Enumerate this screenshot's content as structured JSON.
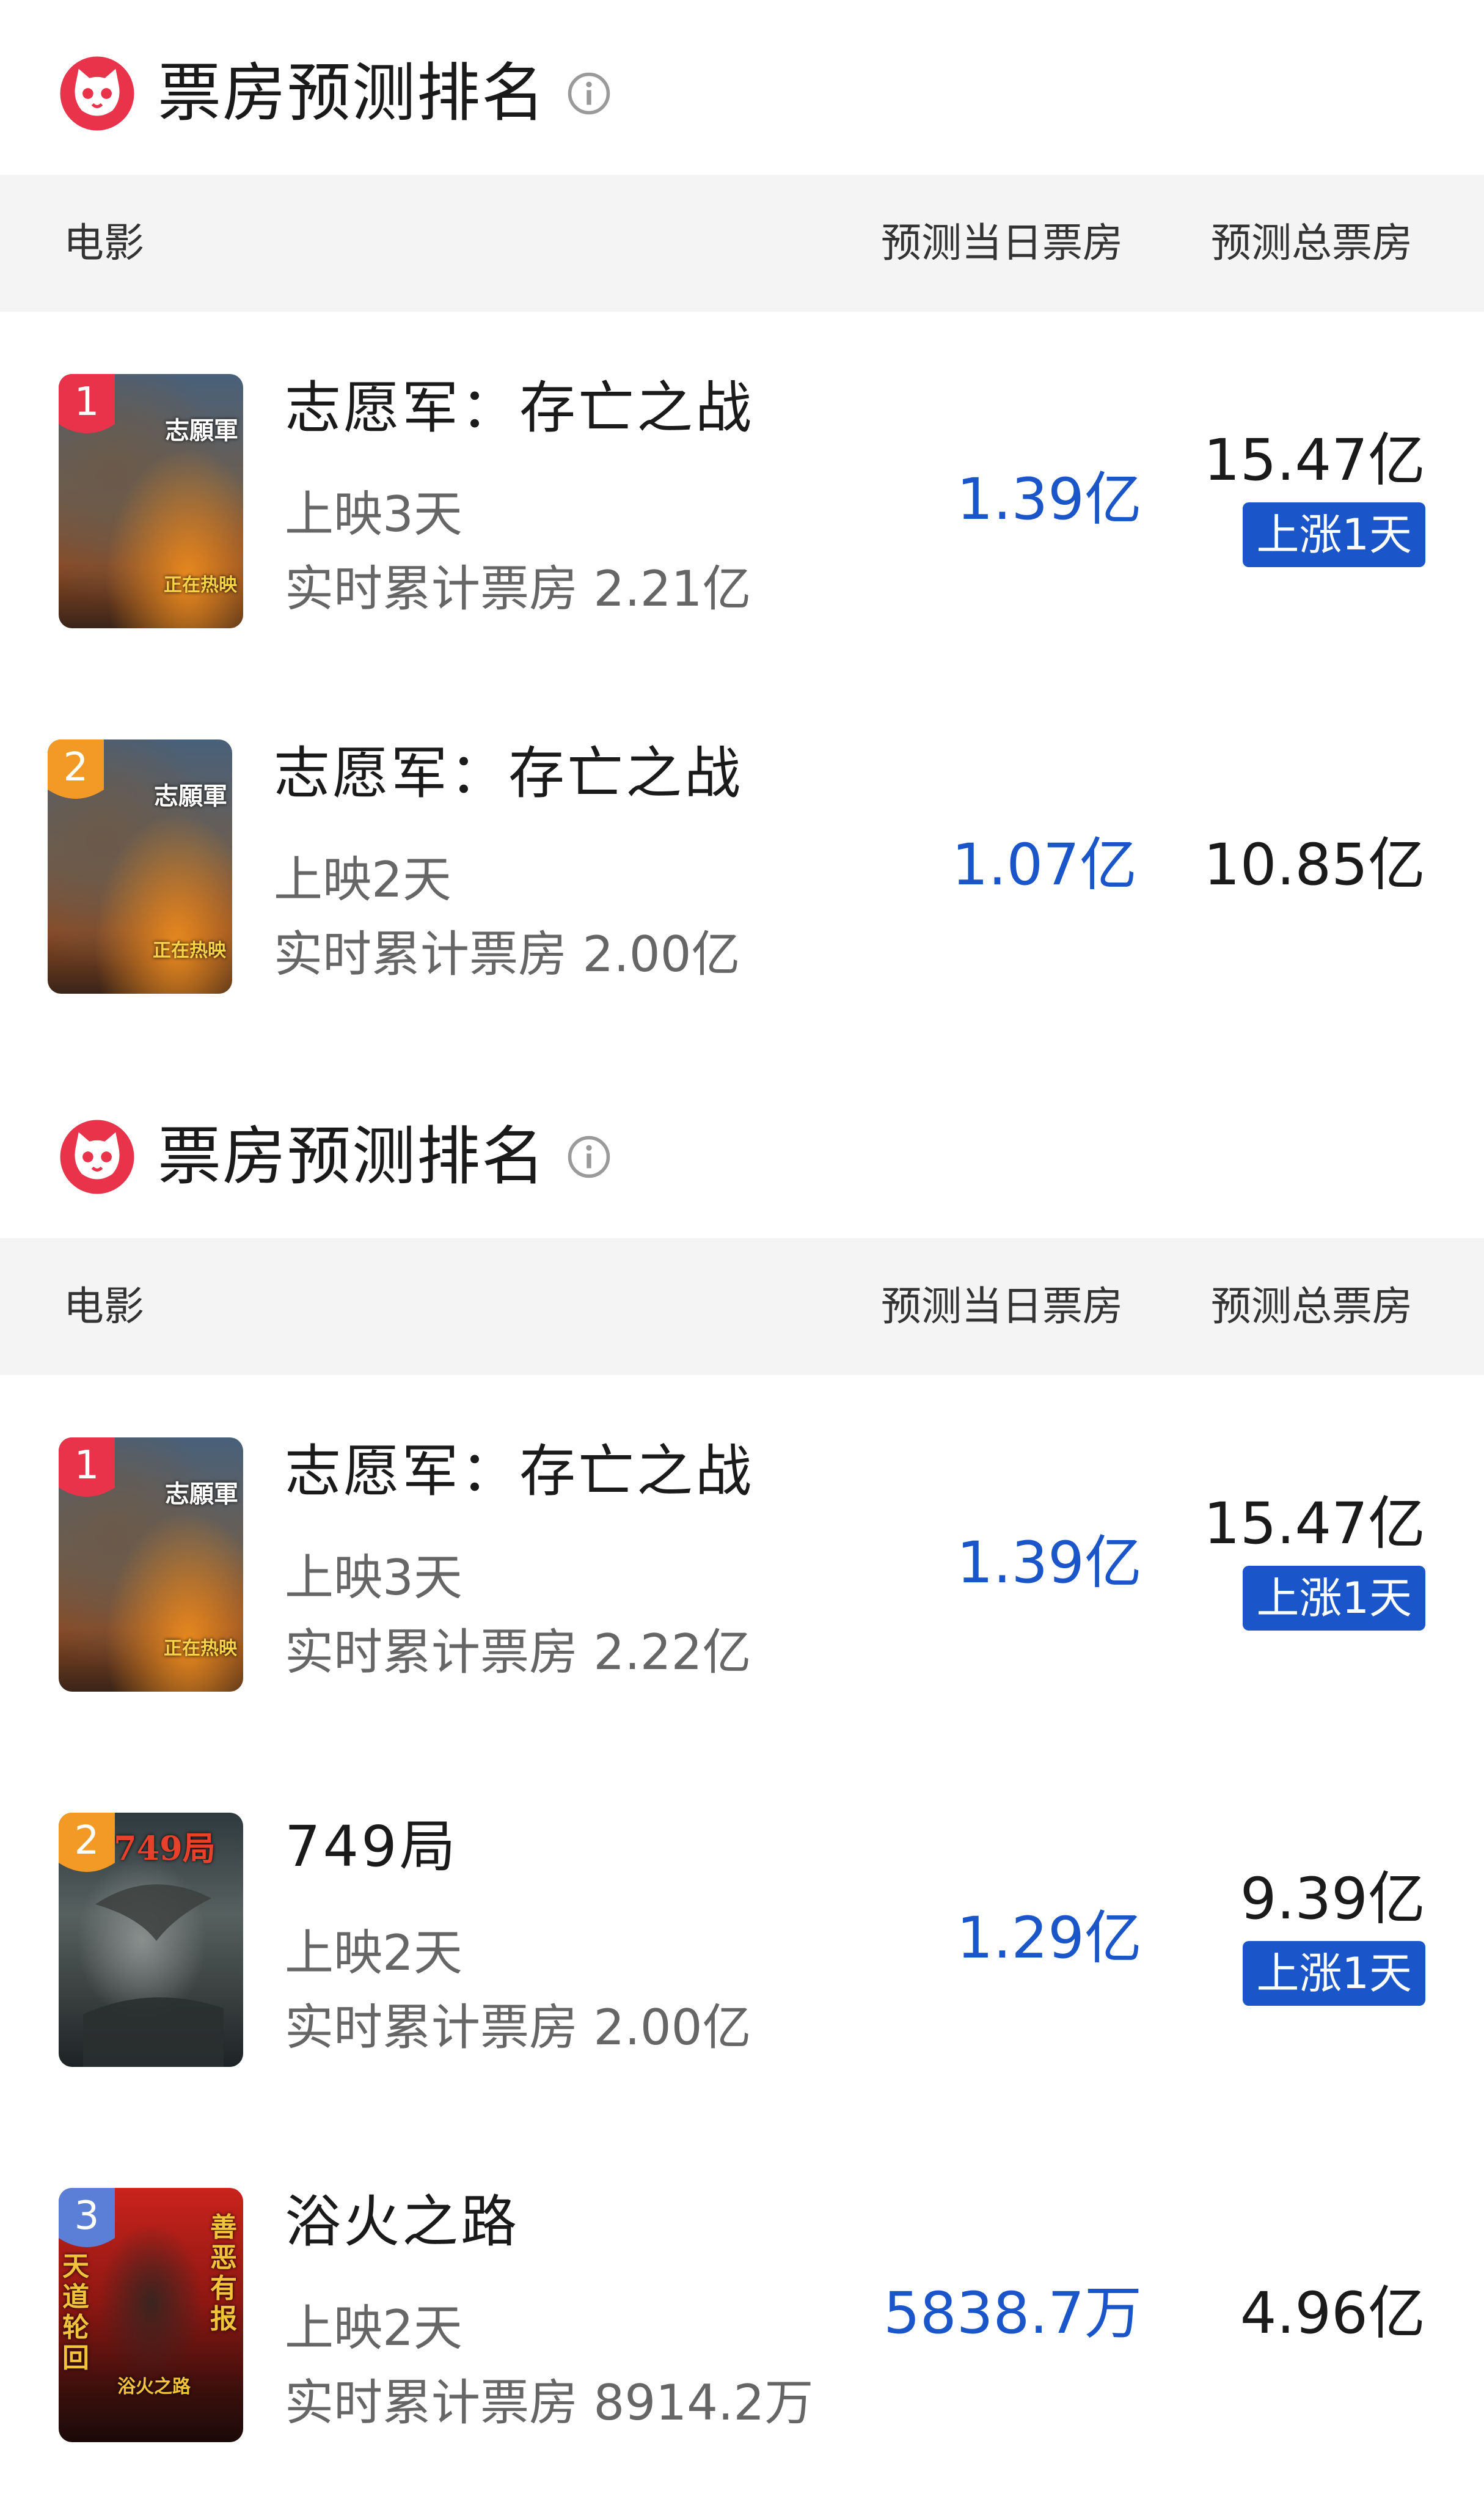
{
  "colors": {
    "accent_blue": "#1a56c9",
    "rank1": "#e8334a",
    "rank2": "#f39a26",
    "rank3": "#5b7fd6",
    "header_bg": "#f4f4f4"
  },
  "sections": [
    {
      "title": "票房预测排名",
      "info_icon": "info-circle-icon",
      "logo_icon": "cat-logo-icon",
      "columns": {
        "movie": "电影",
        "daily": "预测当日票房",
        "total": "预测总票房"
      },
      "rows": [
        {
          "rank": "1",
          "name": "志愿军：存亡之战",
          "days": "上映3天",
          "cumulative": "实时累计票房 2.21亿",
          "daily": "1.39亿",
          "total": "15.47亿",
          "badge": "上涨1天",
          "poster_text": [
            "志願軍",
            "正在热映"
          ]
        },
        {
          "rank": "2",
          "name": "志愿军：存亡之战",
          "days": "上映2天",
          "cumulative": "实时累计票房 2.00亿",
          "daily": "1.07亿",
          "total": "10.85亿",
          "badge": "",
          "poster_text": [
            "志願軍",
            "正在热映"
          ]
        }
      ]
    },
    {
      "title": "票房预测排名",
      "info_icon": "info-circle-icon",
      "logo_icon": "cat-logo-icon",
      "columns": {
        "movie": "电影",
        "daily": "预测当日票房",
        "total": "预测总票房"
      },
      "rows": [
        {
          "rank": "1",
          "name": "志愿军：存亡之战",
          "days": "上映3天",
          "cumulative": "实时累计票房 2.22亿",
          "daily": "1.39亿",
          "total": "15.47亿",
          "badge": "上涨1天",
          "poster_text": [
            "志願軍",
            "正在热映"
          ]
        },
        {
          "rank": "2",
          "name": "749局",
          "days": "上映2天",
          "cumulative": "实时累计票房 2.00亿",
          "daily": "1.29亿",
          "total": "9.39亿",
          "badge": "上涨1天",
          "poster_text": [
            "749局"
          ]
        },
        {
          "rank": "3",
          "name": "浴火之路",
          "days": "上映2天",
          "cumulative": "实时累计票房 8914.2万",
          "daily": "5838.7万",
          "total": "4.96亿",
          "badge": "",
          "poster_text": [
            "天道轮回",
            "善恶有报",
            "浴火之路"
          ]
        }
      ]
    }
  ]
}
